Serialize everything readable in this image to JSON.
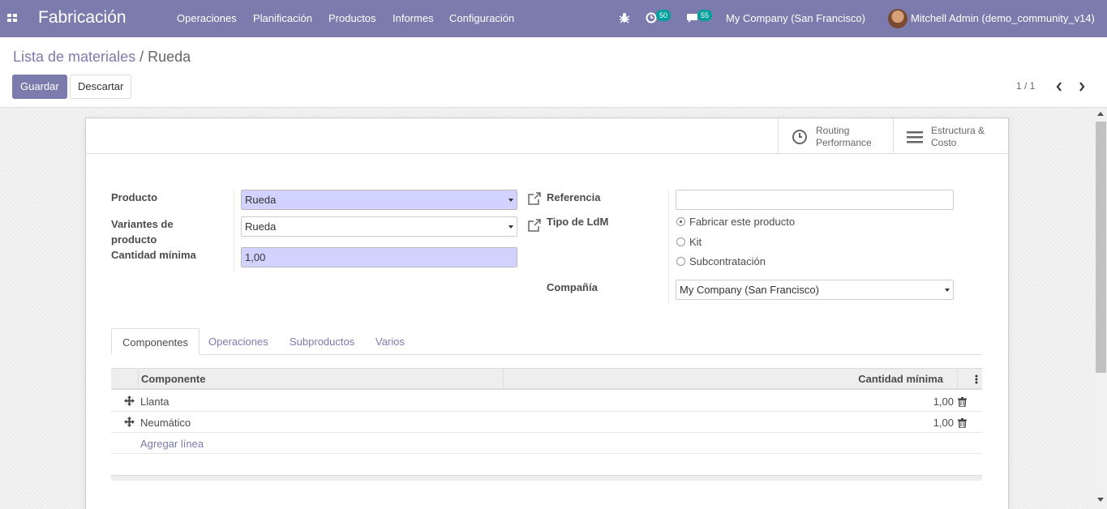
{
  "navbar": {
    "app_title": "Fabricación",
    "menu": [
      "Operaciones",
      "Planificación",
      "Productos",
      "Informes",
      "Configuración"
    ],
    "activity_count": "50",
    "message_count": "55",
    "company": "My Company (San Francisco)",
    "user": "Mitchell Admin (demo_community_v14)"
  },
  "control_panel": {
    "breadcrumb_parent": "Lista de materiales",
    "breadcrumb_separator": "/",
    "breadcrumb_current": "Rueda",
    "save_label": "Guardar",
    "discard_label": "Descartar",
    "pager": "1 / 1"
  },
  "smart_buttons": {
    "routing": [
      "Routing",
      "Performance"
    ],
    "structure": [
      "Estructura &",
      "Costo"
    ]
  },
  "form": {
    "product_label": "Producto",
    "product_value": "Rueda",
    "variants_label_1": "Variantes de",
    "variants_label_2": "producto",
    "variants_value": "Rueda",
    "min_qty_label": "Cantidad mínima",
    "min_qty_value": "1,00",
    "reference_label": "Referencia",
    "reference_value": "",
    "bom_type_label": "Tipo de LdM",
    "bom_type_options": [
      "Fabricar este producto",
      "Kit",
      "Subcontratación"
    ],
    "bom_type_selected": "Fabricar este producto",
    "company_label": "Compañía",
    "company_value": "My Company (San Francisco)"
  },
  "tabs": [
    "Componentes",
    "Operaciones",
    "Subproductos",
    "Varios"
  ],
  "active_tab": "Componentes",
  "components_table": {
    "columns": [
      "Componente",
      "Cantidad mínima"
    ],
    "rows": [
      {
        "component": "Llanta",
        "qty": "1,00"
      },
      {
        "component": "Neumático",
        "qty": "1,00"
      }
    ],
    "add_line_label": "Agregar línea"
  },
  "colors": {
    "brand": "#7c7bad",
    "required_field": "#d2d2ff",
    "badge": "#00a09d"
  }
}
